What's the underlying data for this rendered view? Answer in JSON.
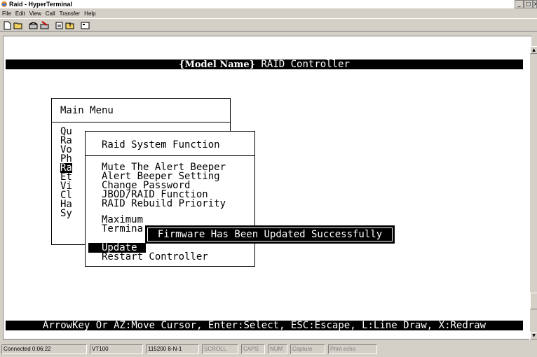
{
  "window": {
    "title": "Raid - HyperTerminal",
    "controls": [
      "_",
      "□",
      "×"
    ]
  },
  "menubar": [
    "File",
    "Edit",
    "View",
    "Call",
    "Transfer",
    "Help"
  ],
  "toolbar": [
    "new-icon",
    "open-icon",
    "phone-icon",
    "disconnect-icon",
    "send-icon",
    "receive-icon",
    "properties-icon"
  ],
  "terminal": {
    "header_model": "{Model Name}",
    "header_rest": " RAID Controller",
    "main_menu": {
      "title": "Main Menu",
      "items": [
        "Qu",
        "Ra",
        "Vo",
        "Ph",
        "Ra",
        "Et",
        "Vi",
        "Cl",
        "Ha",
        "Sy"
      ],
      "selected_index": 4
    },
    "submenu": {
      "title": "Raid System Function",
      "items": [
        "Mute The Alert Beeper",
        "Alert Beeper Setting",
        "Change Password",
        "JBOD/RAID Function",
        "RAID Rebuild Priority",
        "Maximum",
        "Termina",
        "Update",
        "Restart Controller"
      ],
      "selected_index": 7
    },
    "popup_message": "Firmware Has Been Updated Successfully",
    "help_bar": "ArrowKey Or AZ:Move Cursor, Enter:Select, ESC:Escape, L:Line Draw, X:Redraw"
  },
  "statusbar": {
    "connected": "Connected 0:06:22",
    "emulation": "VT100",
    "settings": "115200 8-N-1",
    "scroll": "SCROLL",
    "caps": "CAPS",
    "num": "NUM",
    "capture": "Capture",
    "print_echo": "Print echo"
  },
  "colors": {
    "background": "#d4d0c8",
    "terminal_bg": "#ffffff",
    "terminal_fg": "#000000",
    "highlight": "#000000"
  }
}
